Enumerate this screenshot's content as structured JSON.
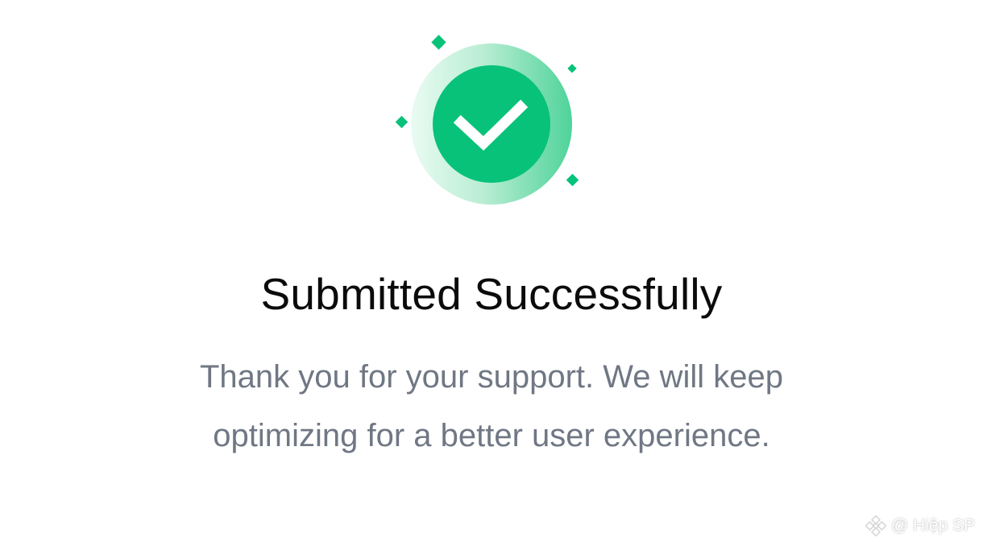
{
  "dialog": {
    "title": "Submitted Successfully",
    "message_line_1": "Thank you for your support. We will keep",
    "message_line_2": "optimizing for a better user experience.",
    "icon": "check-circle-icon"
  },
  "watermark": {
    "text": "@ Hiệp SP",
    "icon": "binance-logo"
  },
  "colors": {
    "accent": "#08c27a",
    "ring_light": "#c9f1de",
    "title": "#0b0b0b",
    "message": "#707784"
  }
}
